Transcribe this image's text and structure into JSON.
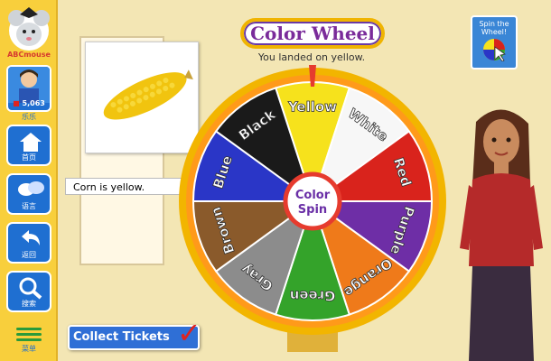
{
  "sidebar": {
    "logo_text": "ABCmouse",
    "ticket_count": "5,063",
    "username": "乐乐",
    "nav": [
      {
        "label": "首页",
        "icon": "home-icon"
      },
      {
        "label": "语言",
        "icon": "language-icon"
      },
      {
        "label": "返回",
        "icon": "back-icon"
      },
      {
        "label": "搜索",
        "icon": "search-icon"
      }
    ],
    "menu_label": "菜单"
  },
  "game": {
    "title": "Color Wheel",
    "result_text": "You landed on yellow.",
    "caption": "Corn is yellow.",
    "spin_button_label": "Spin the Wheel!",
    "collect_label": "Collect Tickets",
    "hub_label_1": "Color",
    "hub_label_2": "Spin",
    "wheel_segments": [
      {
        "label": "Yellow",
        "color": "#f6e21c",
        "text_color": "#ffffff"
      },
      {
        "label": "White",
        "color": "#f7f7f7",
        "text_color": "#ffffff"
      },
      {
        "label": "Red",
        "color": "#d9231c",
        "text_color": "#ffffff"
      },
      {
        "label": "Purple",
        "color": "#6e2ea6",
        "text_color": "#ffffff"
      },
      {
        "label": "Orange",
        "color": "#ef7a1a",
        "text_color": "#ffffff"
      },
      {
        "label": "Green",
        "color": "#34a32a",
        "text_color": "#ffffff"
      },
      {
        "label": "Gray",
        "color": "#8c8c8c",
        "text_color": "#ffffff"
      },
      {
        "label": "Brown",
        "color": "#8a5a2b",
        "text_color": "#ffffff"
      },
      {
        "label": "Blue",
        "color": "#2a36c7",
        "text_color": "#ffffff"
      },
      {
        "label": "Black",
        "color": "#1a1a1a",
        "text_color": "#ffffff"
      }
    ]
  },
  "colors": {
    "sidebar_bg": "#f8cf3c",
    "nav_blue": "#1f6fd1",
    "title_purple": "#7a2b9a",
    "checkmark": "#e0231f"
  }
}
